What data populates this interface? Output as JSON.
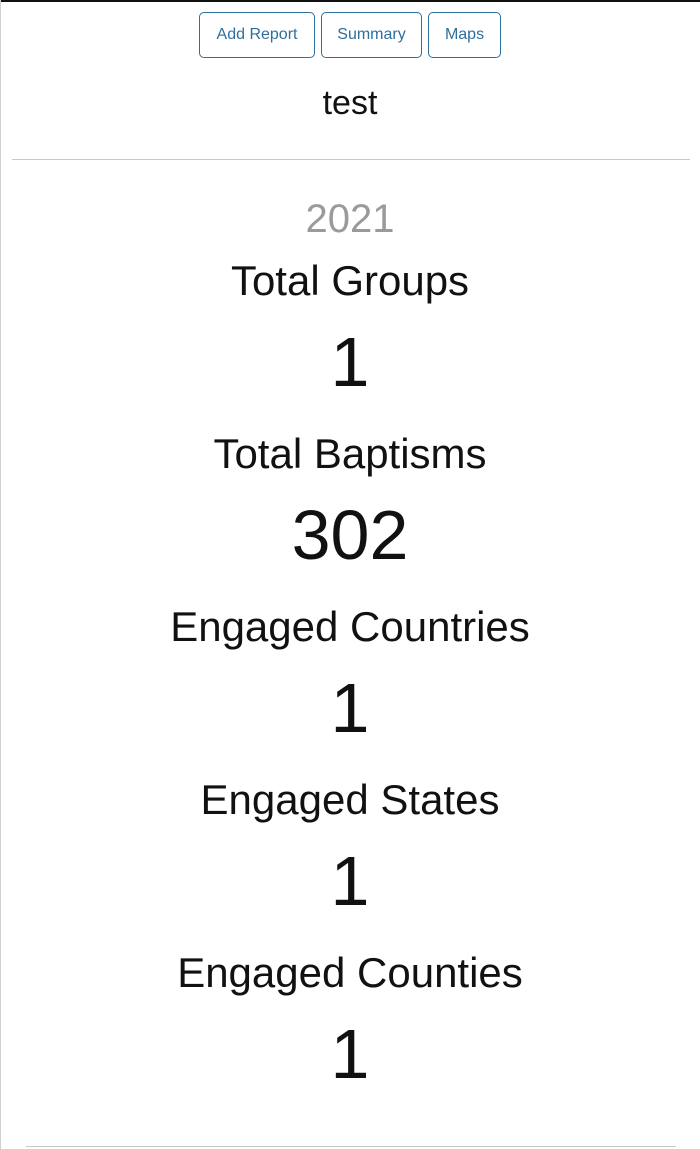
{
  "nav": {
    "add_report": "Add Report",
    "summary": "Summary",
    "maps": "Maps"
  },
  "header": {
    "title": "test"
  },
  "report": {
    "year": "2021",
    "stats": [
      {
        "label": "Total Groups",
        "value": "1"
      },
      {
        "label": "Total Baptisms",
        "value": "302"
      },
      {
        "label": "Engaged Countries",
        "value": "1"
      },
      {
        "label": "Engaged States",
        "value": "1"
      },
      {
        "label": "Engaged Counties",
        "value": "1"
      }
    ]
  },
  "colors": {
    "accent": "#2f6f9c",
    "muted_text": "#9a9a9a",
    "text": "#111111",
    "divider": "#c8c8c8"
  }
}
